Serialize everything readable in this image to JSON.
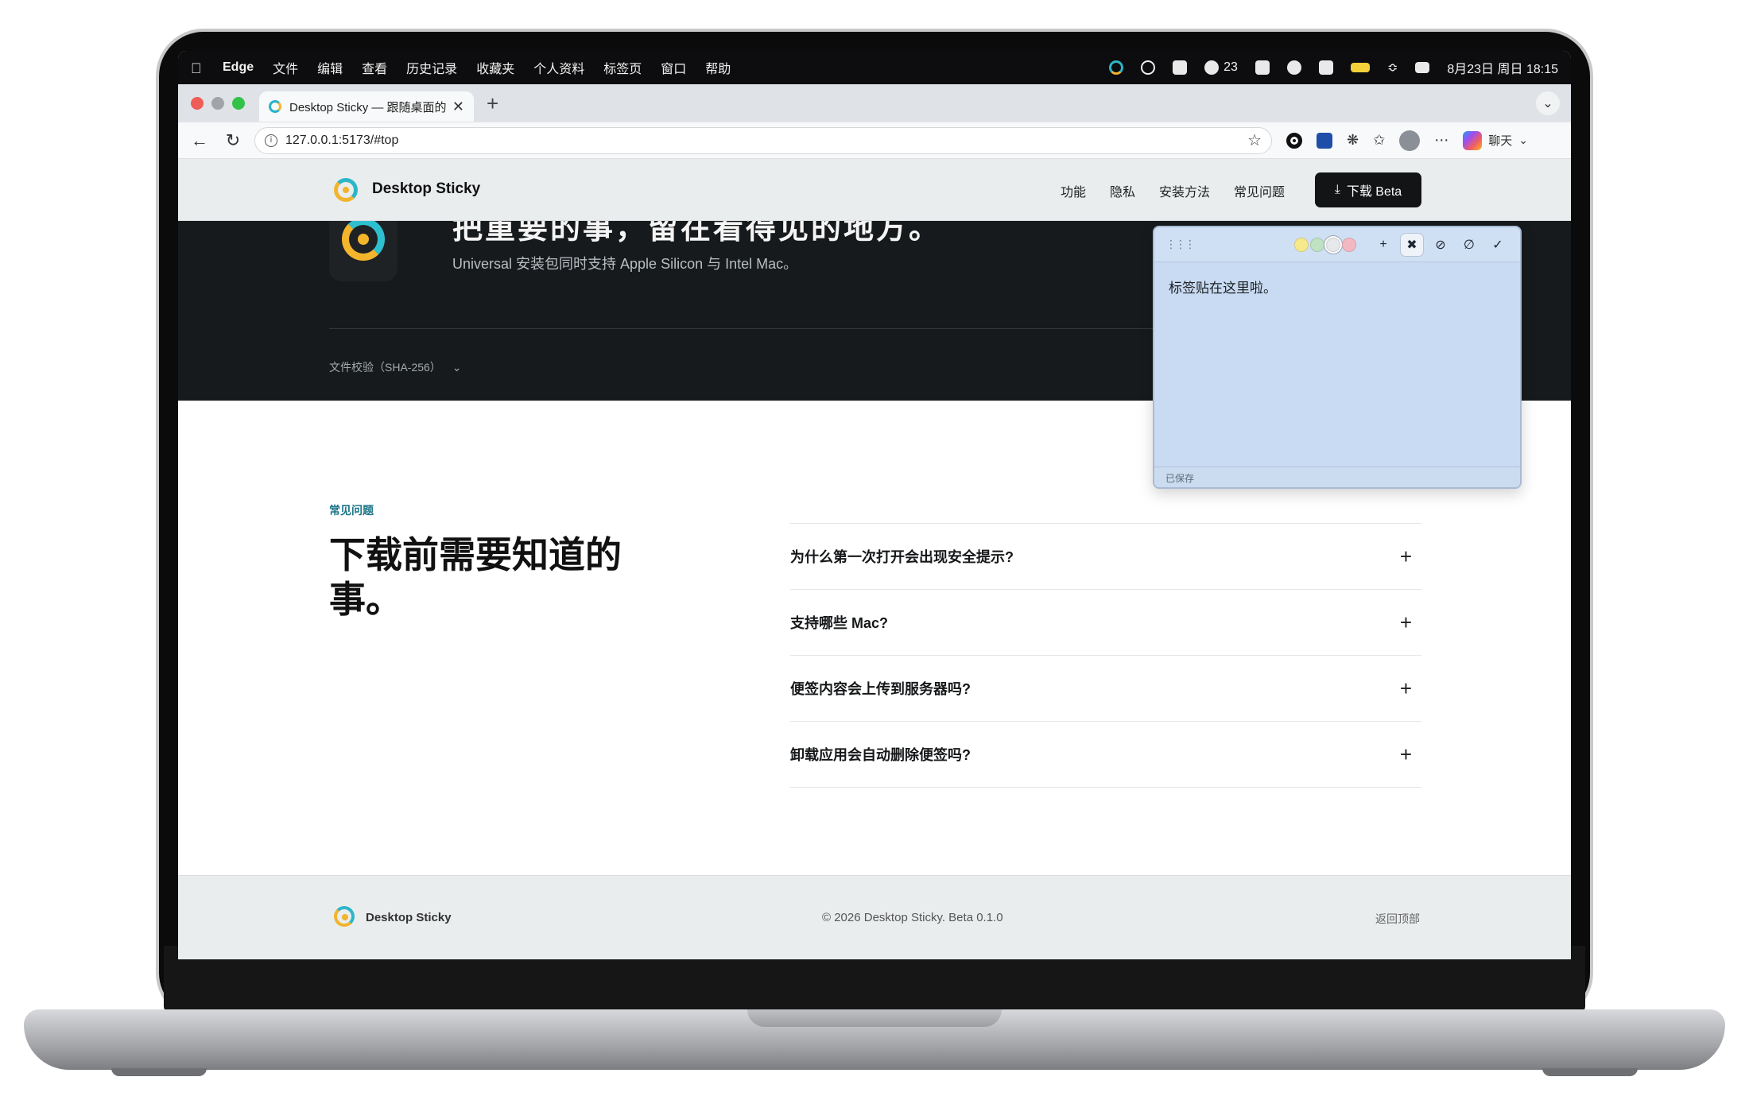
{
  "menubar": {
    "app_name": "Edge",
    "menus": [
      "文件",
      "编辑",
      "查看",
      "历史记录",
      "收藏夹",
      "个人资料",
      "标签页",
      "窗口",
      "帮助"
    ],
    "wechat_count": "23",
    "clock": "8月23日 周日 18:15"
  },
  "browser": {
    "tab_title": "Desktop Sticky — 跟随桌面的 Ma",
    "url": "127.0.0.1:5173/#top",
    "copilot_label": "聊天"
  },
  "site": {
    "brand": "Desktop Sticky",
    "nav": [
      "功能",
      "隐私",
      "安装方法",
      "常见问题"
    ],
    "download_label": "下载 Beta",
    "hero_title": "把重要的事，留在看得见的地方。",
    "hero_subtitle": "Universal 安装包同时支持 Apple Silicon 与 Intel Mac。",
    "checksum_label": "文件校验（SHA-256）"
  },
  "sticky": {
    "text": "标签贴在这里啦。",
    "status": "已保存",
    "colors": [
      "#f5e98c",
      "#bfe3c2",
      "#e6e8ec",
      "#f4b8c3"
    ]
  },
  "faq": {
    "kicker": "常见问题",
    "title": "下载前需要知道的事。",
    "items": [
      "为什么第一次打开会出现安全提示?",
      "支持哪些 Mac?",
      "便签内容会上传到服务器吗?",
      "卸载应用会自动删除便签吗?"
    ]
  },
  "footer": {
    "brand": "Desktop Sticky",
    "copyright": "© 2026 Desktop Sticky. Beta 0.1.0",
    "back_to_top": "返回顶部"
  }
}
